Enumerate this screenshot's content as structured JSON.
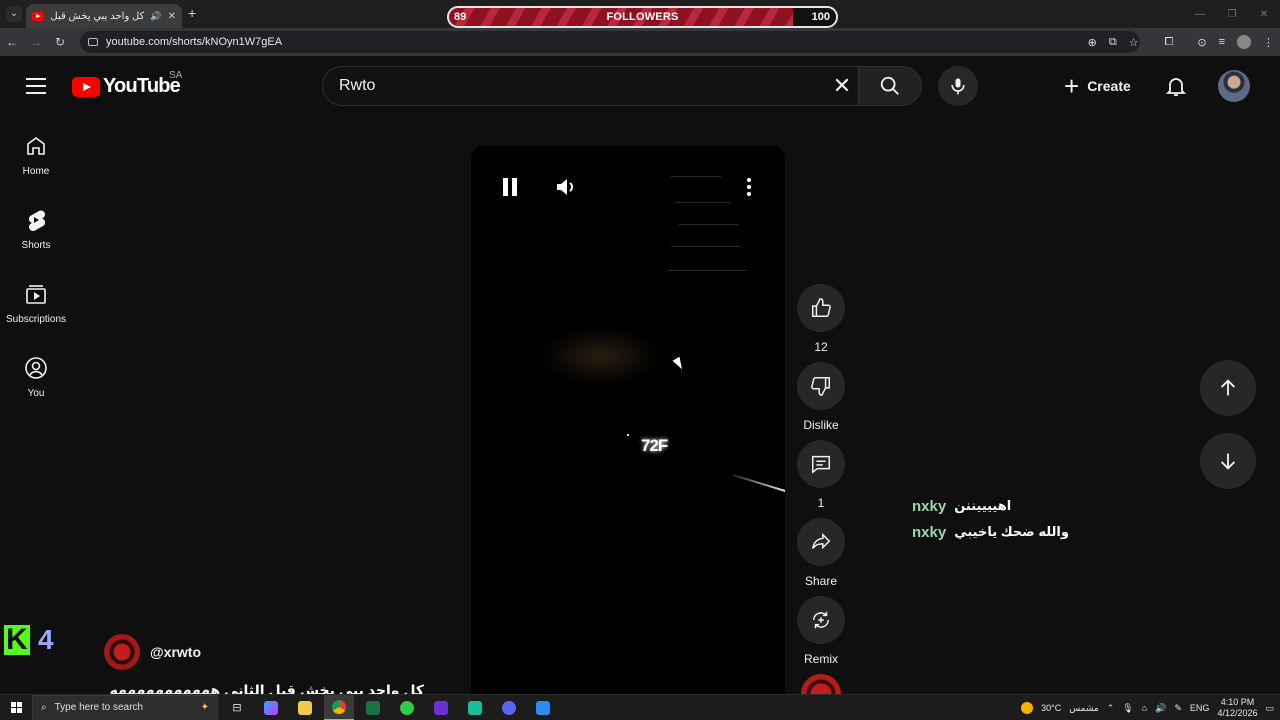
{
  "browser": {
    "tab_title": "كل واحد يبي يخش قبل الثاني",
    "url": "youtube.com/shorts/kNOyn1W7gEA"
  },
  "followers_overlay": {
    "label": "FOLLOWERS",
    "current": "89",
    "goal": "100",
    "progress": 0.89
  },
  "header": {
    "logo_text": "YouTube",
    "region": "SA",
    "search_value": "Rwto",
    "create_label": "Create"
  },
  "sidebar": {
    "items": [
      {
        "label": "Home",
        "icon": "home-icon"
      },
      {
        "label": "Shorts",
        "icon": "shorts-icon"
      },
      {
        "label": "Subscriptions",
        "icon": "subscriptions-icon"
      },
      {
        "label": "You",
        "icon": "you-icon"
      }
    ]
  },
  "video": {
    "overlay_text": "72F"
  },
  "actions": {
    "like_count": "12",
    "dislike_label": "Dislike",
    "comment_count": "1",
    "share_label": "Share",
    "remix_label": "Remix"
  },
  "chat": [
    {
      "user": "nxky",
      "message": "اهييييننن"
    },
    {
      "user": "nxky",
      "message": "والله ضحك ياخيبي"
    }
  ],
  "k4_overlay": {
    "letter": "K",
    "number": "4"
  },
  "channel": {
    "handle": "@xrwto",
    "caption": "كل واحد يبي يخش قبل الثاني هههههههههههه"
  },
  "taskbar": {
    "search_placeholder": "Type here to search",
    "weather": "30°C",
    "weather_desc": "مشمس",
    "lang": "ENG",
    "time": "4:10 PM",
    "date": "4/12/2026"
  },
  "colors": {
    "youtube_red": "#ff0000",
    "kick_green": "#53fc18",
    "chat_user": "#9ad7b2"
  }
}
